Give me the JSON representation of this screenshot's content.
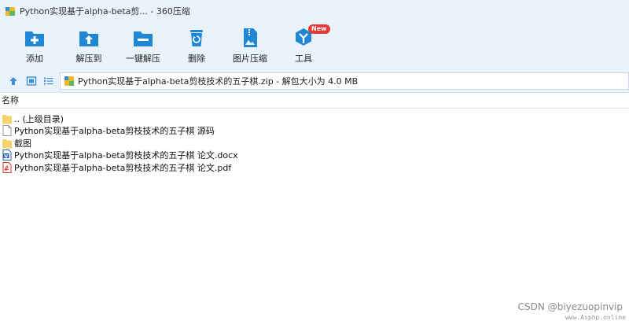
{
  "window": {
    "title": "Python实现基于alpha-beta剪...  - 360压缩"
  },
  "toolbar": {
    "items": [
      {
        "label": "添加",
        "icon": "add-icon"
      },
      {
        "label": "解压到",
        "icon": "extract-to-icon"
      },
      {
        "label": "一键解压",
        "icon": "one-click-extract-icon"
      },
      {
        "label": "删除",
        "icon": "delete-icon"
      },
      {
        "label": "图片压缩",
        "icon": "image-compress-icon"
      },
      {
        "label": "工具",
        "icon": "tools-icon",
        "badge": "New"
      }
    ]
  },
  "address": {
    "path": "Python实现基于alpha-beta剪枝技术的五子棋.zip - 解包大小为 4.0 MB"
  },
  "list": {
    "column_name": "名称",
    "items": [
      {
        "name": ".. (上级目录)",
        "icon": "folder-icon"
      },
      {
        "name": "Python实现基于alpha-beta剪枝技术的五子棋 源码",
        "icon": "file-icon"
      },
      {
        "name": "截图",
        "icon": "folder-icon"
      },
      {
        "name": "Python实现基于alpha-beta剪枝技术的五子棋 论文.docx",
        "icon": "word-doc-icon"
      },
      {
        "name": "Python实现基于alpha-beta剪枝技术的五子棋 论文.pdf",
        "icon": "pdf-icon"
      }
    ]
  },
  "watermark": {
    "text": "CSDN @biyezuopinvip",
    "site": "www.Asphp.online"
  },
  "colors": {
    "toolbar_bg": "#eaf3fc",
    "icon_blue": "#1f87d6",
    "folder_yellow": "#f7d46b",
    "badge_red": "#e53935"
  }
}
